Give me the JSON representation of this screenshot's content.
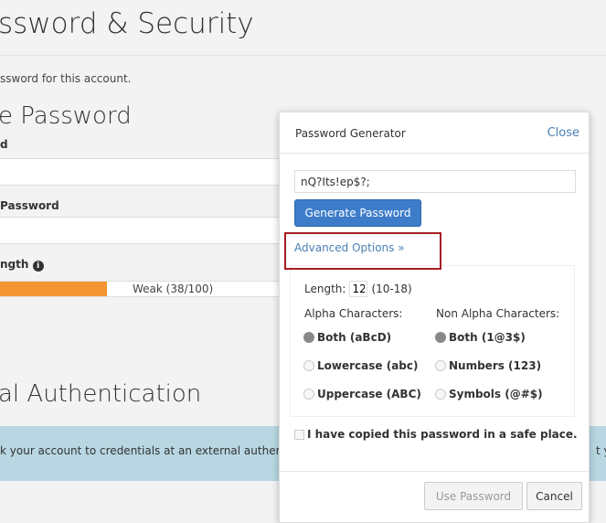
{
  "page": {
    "title": "ssword & Security",
    "description": "ssword for this account.",
    "section_title": "e Password",
    "field1_label": "d",
    "field2_label": "Password",
    "strength_label": "ngth",
    "strength": {
      "text": "Weak (38/100)",
      "percent": 38,
      "color": "#f39530"
    },
    "external_title": "al Authentication",
    "external_text": "k your account to credentials at an external authenti",
    "external_text_right": "t y"
  },
  "modal": {
    "title": "Password Generator",
    "close": "Close",
    "password": "nQ?Its!ep$?;",
    "generate": "Generate Password",
    "advanced": "Advanced Options »",
    "length_label": "Length:",
    "length_value": "12",
    "length_range": "(10-18)",
    "alpha_label": "Alpha Characters:",
    "alpha_options": [
      {
        "label": "Both (aBcD)",
        "selected": true
      },
      {
        "label": "Lowercase (abc)",
        "selected": false
      },
      {
        "label": "Uppercase (ABC)",
        "selected": false
      }
    ],
    "nonalpha_label": "Non Alpha Characters:",
    "nonalpha_options": [
      {
        "label": "Both (1@3$)",
        "selected": true
      },
      {
        "label": "Numbers (123)",
        "selected": false
      },
      {
        "label": "Symbols (@#$)",
        "selected": false
      }
    ],
    "copied_label": "I have copied this password in a safe place.",
    "copied": false,
    "use_password": "Use Password",
    "cancel": "Cancel"
  },
  "colors": {
    "accent": "#3d7cc9",
    "highlight": "#a51d24",
    "band": "#b8d7e2"
  }
}
